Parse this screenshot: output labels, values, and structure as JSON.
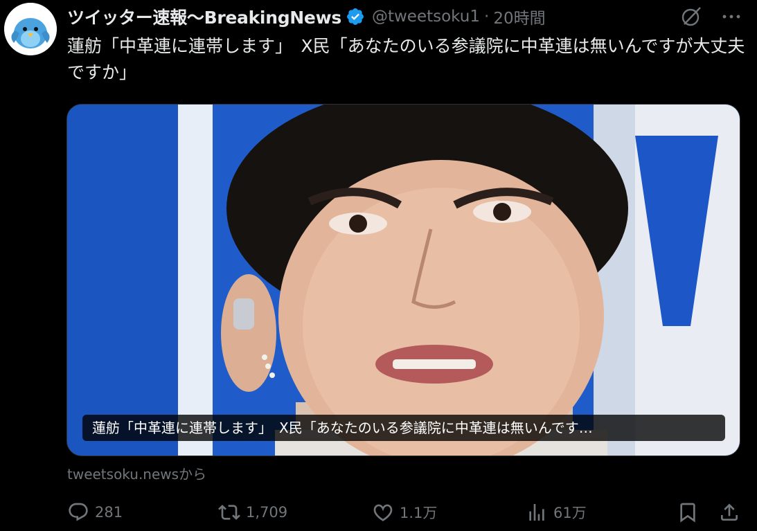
{
  "account": {
    "display_name": "ツイッター速報〜BreakingNews",
    "handle": "@tweetsoku1",
    "separator": "·",
    "time": "20時間"
  },
  "tweet": {
    "text": "蓮舫「中革連に連帯します」　X民「あなたのいる参議院に中革連は無いんですが大丈夫ですか」"
  },
  "card": {
    "caption": "蓮舫「中革連に連帯します」　X民「あなたのいる参議院に中革連は無いんです…",
    "source": "tweetsoku.newsから"
  },
  "actions": {
    "reply_count": "281",
    "repost_count": "1,709",
    "like_count": "1.1万",
    "view_count": "61万"
  },
  "icons": {
    "verified": "verified-badge-icon",
    "grok": "grok-icon",
    "more": "more-dots-icon",
    "reply": "reply-icon",
    "repost": "repost-icon",
    "like": "heart-icon",
    "views": "views-icon",
    "bookmark": "bookmark-icon",
    "share": "share-icon"
  },
  "colors": {
    "background": "#000000",
    "text": "#e7e9ea",
    "muted": "#71767b",
    "verified": "#1d9bf0"
  }
}
